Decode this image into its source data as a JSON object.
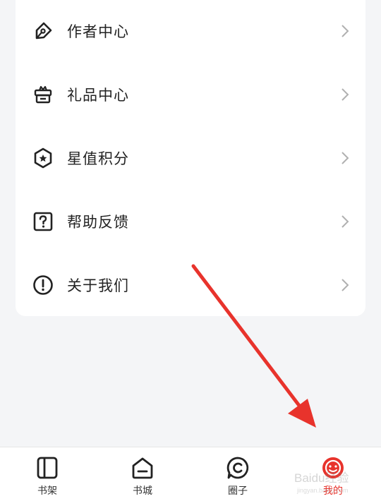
{
  "menu": {
    "items": [
      {
        "label": "作者中心",
        "icon": "pen-edit-icon"
      },
      {
        "label": "礼品中心",
        "icon": "gift-box-icon"
      },
      {
        "label": "星值积分",
        "icon": "star-hexagon-icon"
      },
      {
        "label": "帮助反馈",
        "icon": "question-square-icon"
      },
      {
        "label": "关于我们",
        "icon": "info-circle-icon"
      }
    ]
  },
  "tabbar": {
    "tabs": [
      {
        "label": "书架",
        "icon": "bookshelf-icon",
        "active": false
      },
      {
        "label": "书城",
        "icon": "bookstore-icon",
        "active": false
      },
      {
        "label": "圈子",
        "icon": "circle-chat-icon",
        "active": false
      },
      {
        "label": "我的",
        "icon": "profile-face-icon",
        "active": true
      }
    ]
  },
  "colors": {
    "accent": "#e8332c",
    "background": "#f4f5f7",
    "card": "#ffffff",
    "annotation_arrow": "#e8332c"
  },
  "watermark": {
    "text": "Baidu经验",
    "subtext": "jingyan.baidu.com"
  }
}
